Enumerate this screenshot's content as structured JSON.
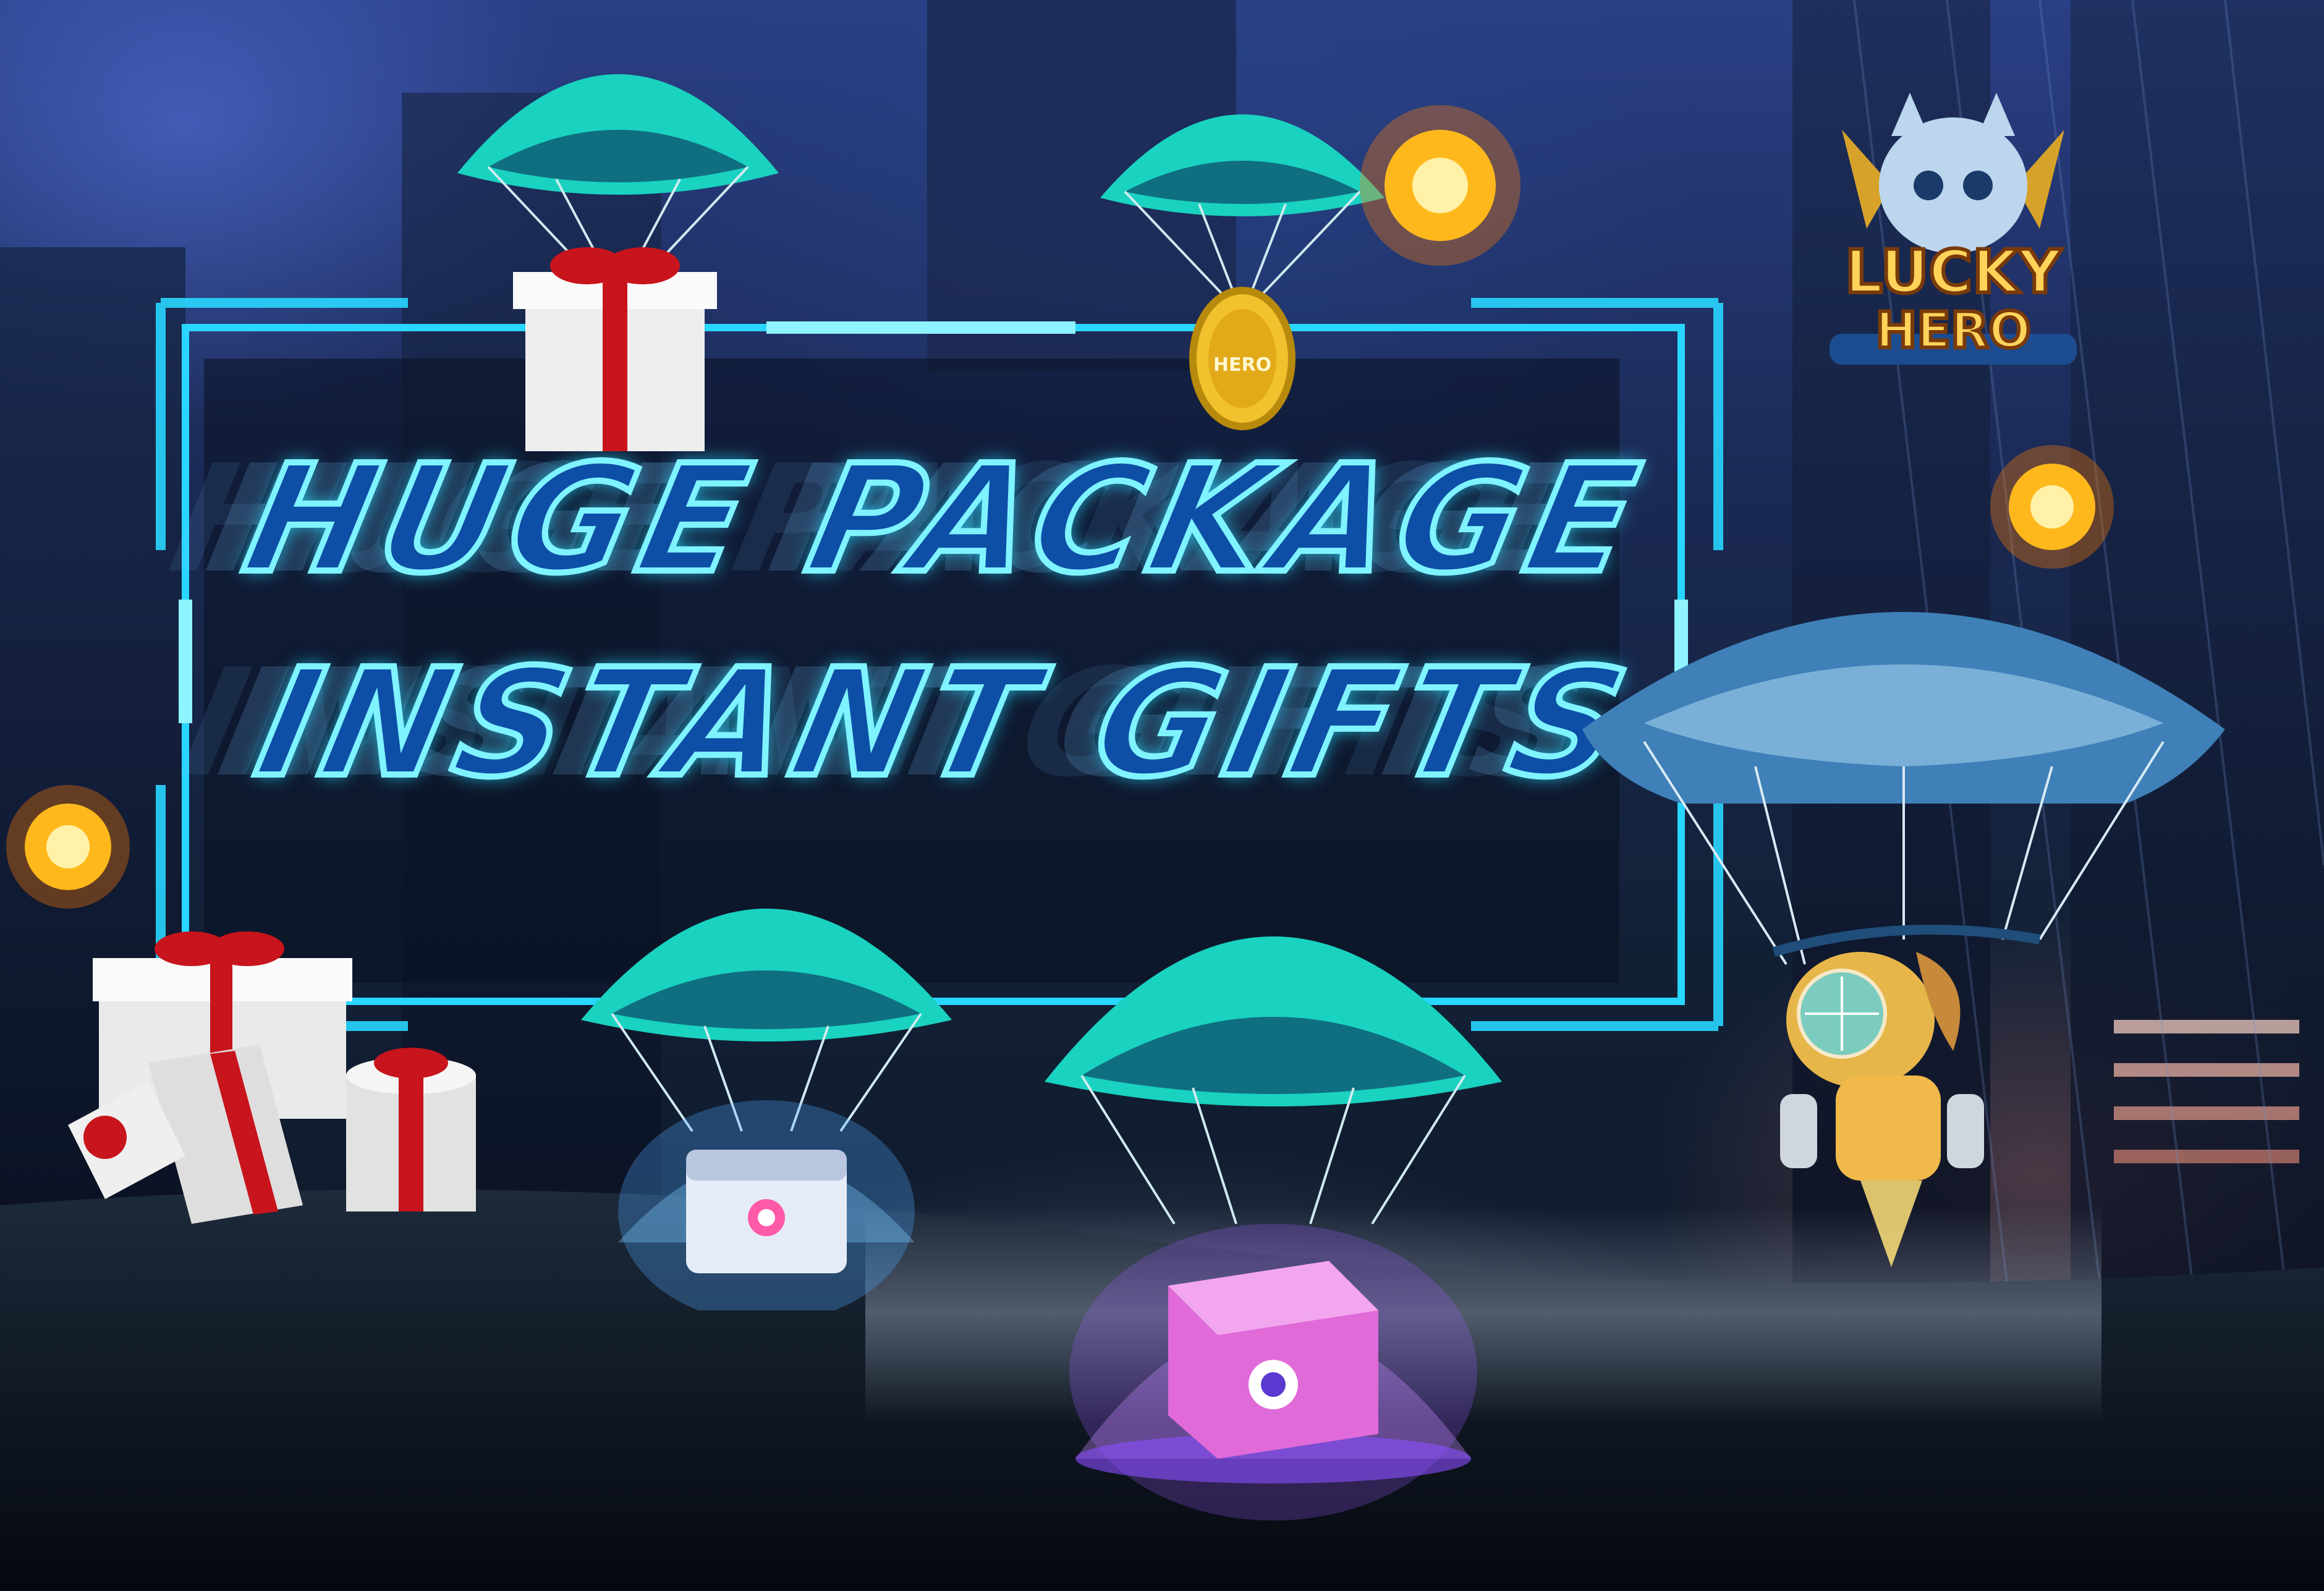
{
  "banner": {
    "title_line_1": "HUGE PACKAGE",
    "title_line_2": "INSTANT GIFTS"
  },
  "logo": {
    "line_1": "LUCKY",
    "line_2": "HERO"
  },
  "coin": {
    "label": "HERO"
  },
  "colors": {
    "frame_cyan": "#29d6ff",
    "parachute_teal": "#1ad2c0",
    "gift_ribbon": "#c8141c",
    "title_fill": "#0d4fa6",
    "explosion": "#ffb81c",
    "mystery_box_pink": "#e06ad8"
  },
  "icons": [
    "parachute-icon",
    "gift-box-icon",
    "gold-coin-icon",
    "explosion-icon",
    "mystery-box-icon",
    "hero-character-icon",
    "lucky-hero-logo"
  ]
}
